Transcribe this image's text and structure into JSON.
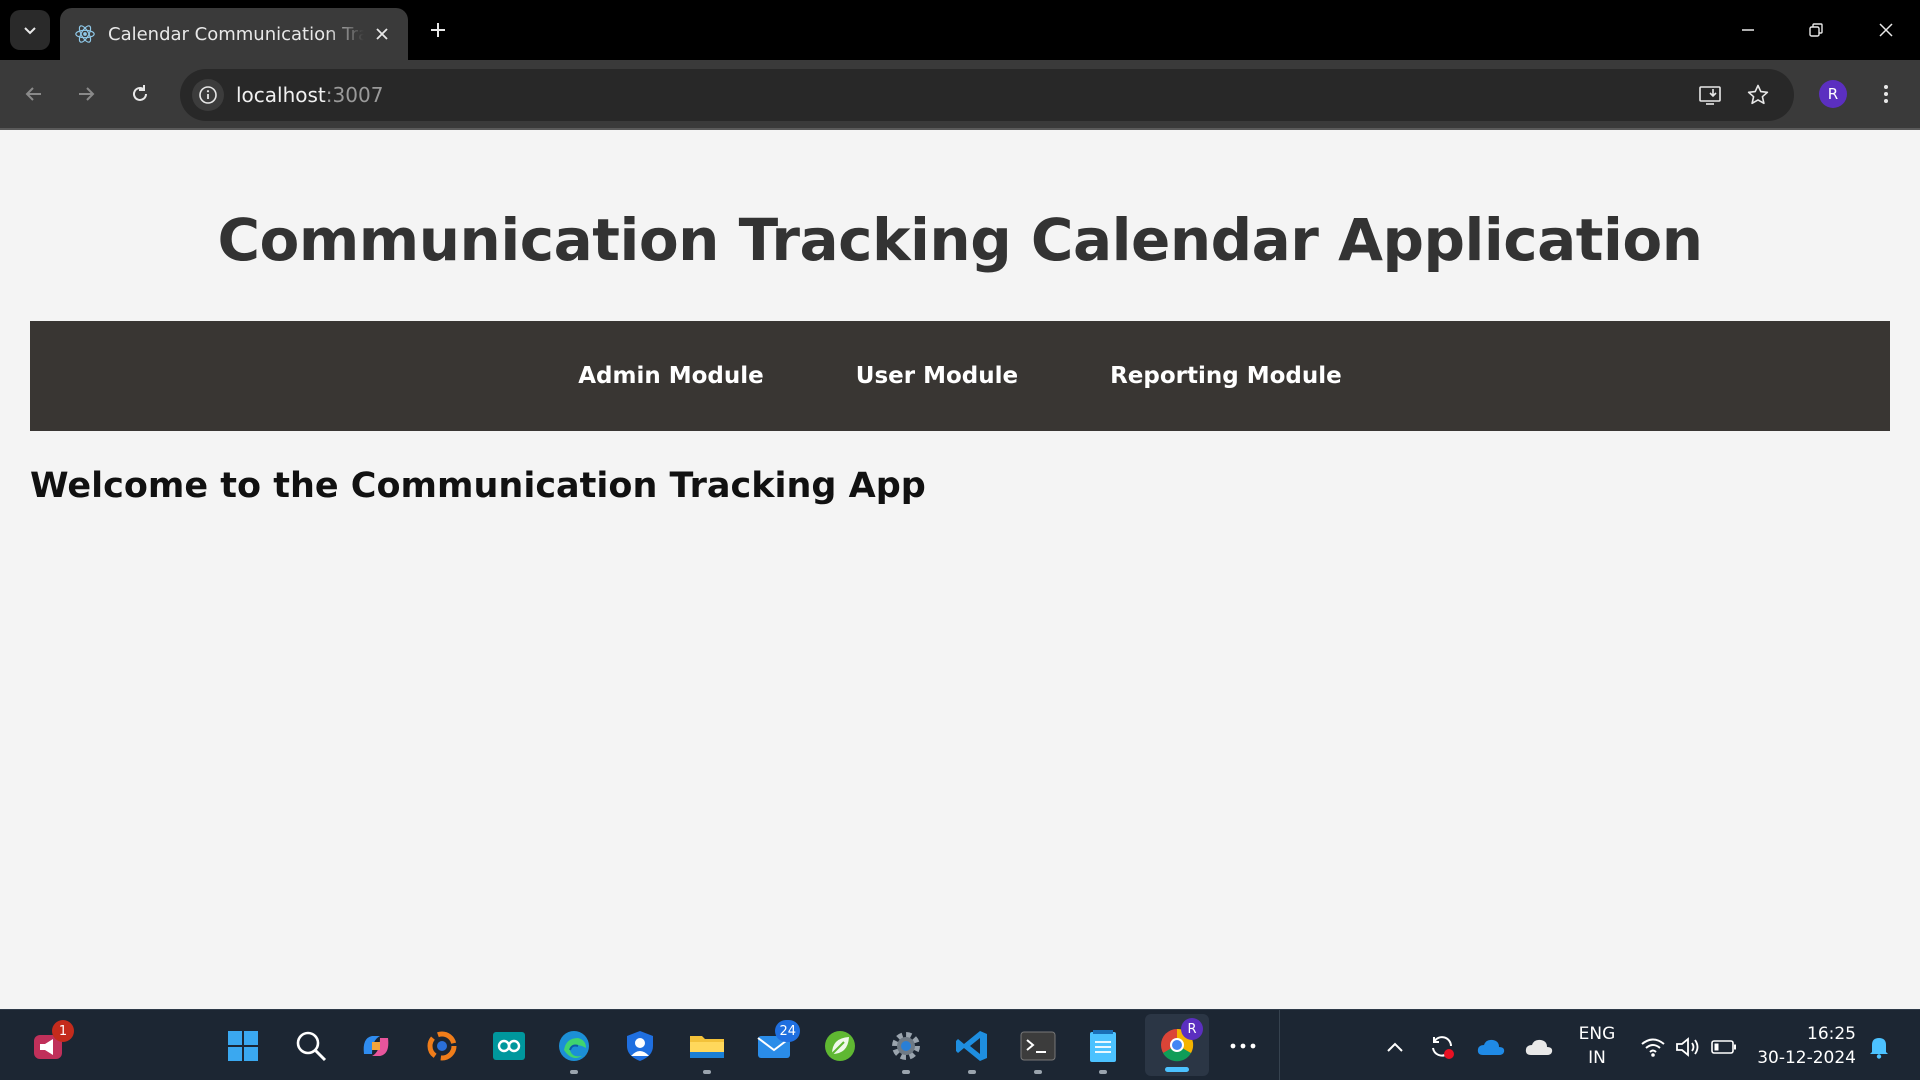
{
  "browser": {
    "tab_title": "Calendar Communication Tracking",
    "url_host": "localhost",
    "url_port": ":3007",
    "profile_initial": "R"
  },
  "page": {
    "title": "Communication Tracking Calendar Application",
    "nav": [
      {
        "label": "Admin Module"
      },
      {
        "label": "User Module"
      },
      {
        "label": "Reporting Module"
      }
    ],
    "welcome": "Welcome to the Communication Tracking App"
  },
  "taskbar": {
    "notif_badge": "1",
    "mail_badge": "24",
    "chrome_badge": "R",
    "lang_top": "ENG",
    "lang_bottom": "IN",
    "time": "16:25",
    "date": "30-12-2024"
  },
  "colors": {
    "navbar": "#393633",
    "title": "#333333",
    "profile": "#5b2fc0",
    "accent": "#4cc2ff"
  }
}
